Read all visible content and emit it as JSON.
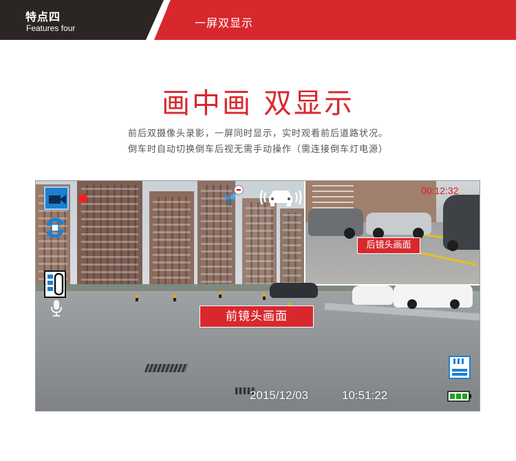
{
  "header": {
    "feature_cn": "特点四",
    "feature_en": "Features four",
    "section_title": "一屏双显示",
    "colors": {
      "dark": "#2b2523",
      "accent": "#d8282e"
    }
  },
  "headline": "画中画 双显示",
  "description": [
    "前后双摄像头录影，一屏同时显示，实时观看前后道路状况。",
    "倒车时自动切换倒车后视无需手动操作（需连接倒车灯电源）"
  ],
  "screen": {
    "front_label": "前镜头画面",
    "rear_label": "后镜头画面",
    "recording_time": "00:12:32",
    "date": "2015/12/03",
    "time": "10:51:22",
    "icons": {
      "mode": "video-camera-icon",
      "recording": "record-dot-icon",
      "sync": "sync-icon",
      "battery_vertical": "battery-level-icon",
      "microphone": "microphone-icon",
      "gps": "satellite-icon",
      "parking": "parking-monitor-icon",
      "storage": "sd-card-icon",
      "battery": "battery-icon"
    }
  }
}
